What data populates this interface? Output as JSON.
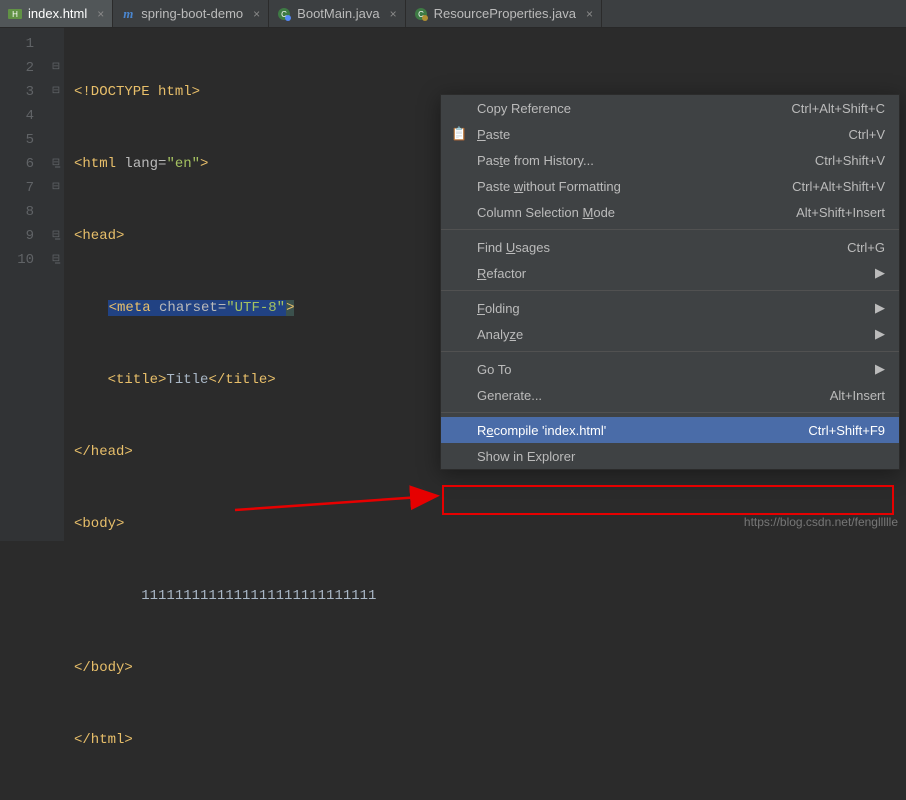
{
  "tabs": [
    {
      "label": "index.html",
      "active": true,
      "icon": "html"
    },
    {
      "label": "spring-boot-demo",
      "active": false,
      "icon": "maven"
    },
    {
      "label": "BootMain.java",
      "active": false,
      "icon": "java"
    },
    {
      "label": "ResourceProperties.java",
      "active": false,
      "icon": "java"
    }
  ],
  "gutter": [
    "1",
    "2",
    "3",
    "4",
    "5",
    "6",
    "7",
    "8",
    "9",
    "10"
  ],
  "code": {
    "l1": "<!DOCTYPE html>",
    "l2_open": "<html ",
    "l2_attr": "lang=",
    "l2_val": "\"en\"",
    "l2_close": ">",
    "l3": "<head>",
    "l4_meta_open": "<meta",
    "l4_attr": " charset=",
    "l4_val": "\"UTF-8\"",
    "l4_close": ">",
    "l5_t1": "<title>",
    "l5_txt": "Title",
    "l5_t2": "</title>",
    "l6": "</head>",
    "l7": "<body>",
    "l8": "1111111111111111111111111111",
    "l9": "</body>",
    "l10": "</html>"
  },
  "menu": {
    "copy_ref": {
      "label": "Copy Reference",
      "shortcut": "Ctrl+Alt+Shift+C"
    },
    "paste": {
      "label": "Paste",
      "shortcut": "Ctrl+V",
      "u": "P"
    },
    "paste_hist": {
      "label": "Paste from History...",
      "shortcut": "Ctrl+Shift+V",
      "u": "t"
    },
    "paste_nofmt": {
      "label": "Paste without Formatting",
      "shortcut": "Ctrl+Alt+Shift+V",
      "u": "w"
    },
    "col_sel": {
      "label": "Column Selection Mode",
      "shortcut": "Alt+Shift+Insert",
      "u": "M"
    },
    "find_usages": {
      "label": "Find Usages",
      "shortcut": "Ctrl+G",
      "u": "U"
    },
    "refactor": {
      "label": "Refactor",
      "u": "R"
    },
    "folding": {
      "label": "Folding",
      "u": "F"
    },
    "analyze": {
      "label": "Analyze",
      "u": "z"
    },
    "goto": {
      "label": "Go To"
    },
    "generate": {
      "label": "Generate...",
      "shortcut": "Alt+Insert"
    },
    "recompile": {
      "label": "Recompile 'index.html'",
      "shortcut": "Ctrl+Shift+F9",
      "u": "e"
    },
    "show_explorer": {
      "label": "Show in Explorer"
    }
  },
  "watermark": "https://blog.csdn.net/fengllllle"
}
